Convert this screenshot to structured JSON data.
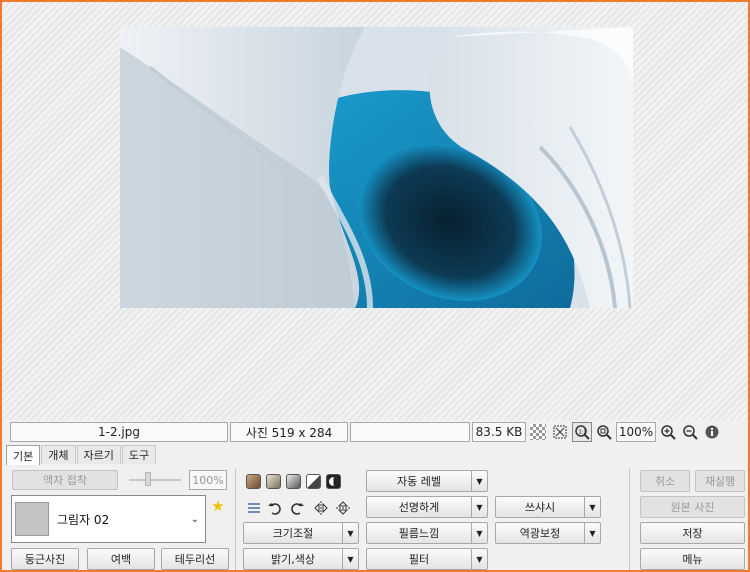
{
  "statusbar": {
    "filename": "1-2.jpg",
    "dimensions": "사진 519 x 284",
    "blank": "",
    "filesize": "83.5 KB",
    "zoom": "100%"
  },
  "tabs": [
    {
      "label": "기본",
      "active": true
    },
    {
      "label": "개체",
      "active": false
    },
    {
      "label": "자르기",
      "active": false
    },
    {
      "label": "도구",
      "active": false
    }
  ],
  "frame_paste_label": "액자 접착",
  "opacity_value": "100%",
  "shadow_select_label": "그림자 02",
  "round_photo_label": "둥근사진",
  "margin_label": "여백",
  "border_label": "테두리선",
  "resize_label": "크기조절",
  "brightness_label": "밝기,색상",
  "auto_level_label": "자동 레벨",
  "sharpen_label": "선명하게",
  "film_label": "필름느낌",
  "filter_label": "필터",
  "sharpen2_label": "쓰샤시",
  "backlight_label": "역광보정",
  "undo_label": "취소",
  "redo_label": "재실행",
  "original_label": "원본 사진",
  "save_label": "저장",
  "menu_label": "메뉴",
  "colors": {
    "window_border": "#f07a2e",
    "accent_star": "#f2c200"
  }
}
